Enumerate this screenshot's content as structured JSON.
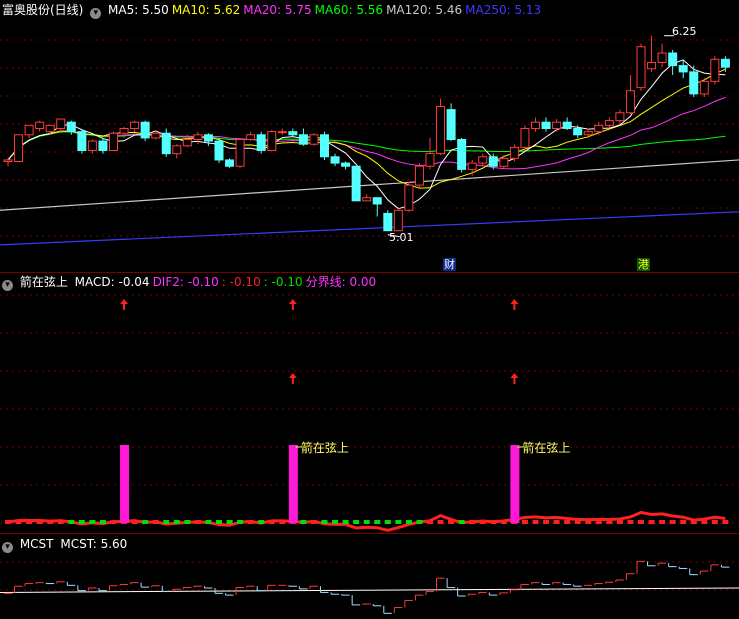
{
  "colors": {
    "bg": "#000000",
    "up": "#ff3a3a",
    "down": "#54ffff",
    "grid": "#7a0000",
    "ma5": "#ffffff",
    "ma10": "#ffff00",
    "ma20": "#ff33ff",
    "ma60": "#00ff00",
    "ma120": "#c8c8c8",
    "ma250": "#3a3aff",
    "signal": "#ff1ad9",
    "macd_red": "#ff2020",
    "macd_green": "#00e000"
  },
  "main": {
    "title": "富奥股份(日线)",
    "icon": "circle-chevron-icon",
    "ma": [
      {
        "label": "MA5: 5.50",
        "color": "#ffffff"
      },
      {
        "label": "MA10: 5.62",
        "color": "#ffff00"
      },
      {
        "label": "MA20: 5.75",
        "color": "#ff33ff"
      },
      {
        "label": "MA60: 5.56",
        "color": "#00ff00"
      },
      {
        "label": "MA120: 5.46",
        "color": "#c8c8c8"
      },
      {
        "label": "MA250: 5.13",
        "color": "#3a3aff"
      }
    ],
    "high_label": "6.25",
    "low_label": "5.01",
    "badge_cai": "财",
    "badge_gang": "港"
  },
  "ind": {
    "title": "箭在弦上",
    "icon": "circle-chevron-icon",
    "values": [
      {
        "label": "MACD: -0.04",
        "color": "#ffffff"
      },
      {
        "label": "DIF2: -0.10",
        "color": "#ff33ff"
      },
      {
        "label": ": -0.10",
        "color": "#ff2020"
      },
      {
        "label": ": -0.10",
        "color": "#00e000"
      },
      {
        "label": "分界线: 0.00",
        "color": "#ff33ff"
      }
    ],
    "signal_label": "箭在弦上"
  },
  "mcst": {
    "title": "MCST",
    "value": "MCST: 5.60",
    "icon": "circle-chevron-icon"
  },
  "candles": [
    [
      5.45,
      5.46,
      5.42,
      5.47
    ],
    [
      5.45,
      5.62,
      5.62,
      5.45
    ],
    [
      5.62,
      5.68,
      5.66,
      5.6
    ],
    [
      5.66,
      5.7,
      5.64,
      5.71
    ],
    [
      5.64,
      5.68,
      5.66,
      5.62
    ],
    [
      5.66,
      5.72,
      5.7,
      5.63
    ],
    [
      5.7,
      5.64,
      5.71,
      5.62
    ],
    [
      5.64,
      5.52,
      5.65,
      5.5
    ],
    [
      5.52,
      5.58,
      5.59,
      5.5
    ],
    [
      5.58,
      5.52,
      5.6,
      5.5
    ],
    [
      5.52,
      5.63,
      5.64,
      5.52
    ],
    [
      5.63,
      5.66,
      5.67,
      5.6
    ],
    [
      5.66,
      5.7,
      5.71,
      5.64
    ],
    [
      5.7,
      5.6,
      5.71,
      5.58
    ],
    [
      5.6,
      5.63,
      5.65,
      5.59
    ],
    [
      5.63,
      5.5,
      5.66,
      5.48
    ],
    [
      5.5,
      5.55,
      5.56,
      5.47
    ],
    [
      5.55,
      5.59,
      5.62,
      5.54
    ],
    [
      5.59,
      5.62,
      5.64,
      5.56
    ],
    [
      5.62,
      5.58,
      5.63,
      5.55
    ],
    [
      5.58,
      5.46,
      5.6,
      5.44
    ],
    [
      5.46,
      5.42,
      5.47,
      5.41
    ],
    [
      5.42,
      5.59,
      5.6,
      5.41
    ],
    [
      5.59,
      5.62,
      5.64,
      5.58
    ],
    [
      5.62,
      5.52,
      5.64,
      5.5
    ],
    [
      5.52,
      5.64,
      5.65,
      5.52
    ],
    [
      5.64,
      5.64,
      5.66,
      5.62
    ],
    [
      5.64,
      5.62,
      5.66,
      5.61
    ],
    [
      5.62,
      5.56,
      5.66,
      5.55
    ],
    [
      5.56,
      5.62,
      5.63,
      5.55
    ],
    [
      5.62,
      5.48,
      5.64,
      5.46
    ],
    [
      5.48,
      5.44,
      5.5,
      5.42
    ],
    [
      5.44,
      5.42,
      5.45,
      5.4
    ],
    [
      5.42,
      5.2,
      5.4,
      5.2
    ],
    [
      5.2,
      5.22,
      5.24,
      5.2
    ],
    [
      5.22,
      5.18,
      5.22,
      5.1
    ],
    [
      5.12,
      5.01,
      5.14,
      5.01
    ],
    [
      5.01,
      5.14,
      5.16,
      5.01
    ],
    [
      5.14,
      5.3,
      5.32,
      5.13
    ],
    [
      5.3,
      5.42,
      5.44,
      5.28
    ],
    [
      5.42,
      5.5,
      5.6,
      5.4
    ],
    [
      5.5,
      5.8,
      5.85,
      5.49
    ],
    [
      5.78,
      5.59,
      5.82,
      5.58
    ],
    [
      5.59,
      5.4,
      5.6,
      5.38
    ],
    [
      5.4,
      5.44,
      5.46,
      5.36
    ],
    [
      5.44,
      5.48,
      5.5,
      5.42
    ],
    [
      5.48,
      5.42,
      5.5,
      5.4
    ],
    [
      5.42,
      5.47,
      5.49,
      5.4
    ],
    [
      5.47,
      5.54,
      5.56,
      5.45
    ],
    [
      5.54,
      5.66,
      5.68,
      5.52
    ],
    [
      5.66,
      5.7,
      5.73,
      5.64
    ],
    [
      5.7,
      5.66,
      5.73,
      5.64
    ],
    [
      5.66,
      5.7,
      5.72,
      5.64
    ],
    [
      5.7,
      5.66,
      5.73,
      5.65
    ],
    [
      5.66,
      5.62,
      5.68,
      5.6
    ],
    [
      5.62,
      5.64,
      5.66,
      5.6
    ],
    [
      5.64,
      5.68,
      5.7,
      5.62
    ],
    [
      5.68,
      5.71,
      5.73,
      5.66
    ],
    [
      5.71,
      5.76,
      5.78,
      5.69
    ],
    [
      5.76,
      5.9,
      6.0,
      5.75
    ],
    [
      5.92,
      6.18,
      6.2,
      5.9
    ],
    [
      6.04,
      6.08,
      6.25,
      6.02
    ],
    [
      6.08,
      6.14,
      6.2,
      6.05
    ],
    [
      6.14,
      6.06,
      6.16,
      6.0
    ],
    [
      6.06,
      6.02,
      6.1,
      5.98
    ],
    [
      6.02,
      5.88,
      6.06,
      5.86
    ],
    [
      5.88,
      5.96,
      5.98,
      5.86
    ],
    [
      5.96,
      6.1,
      6.12,
      5.94
    ],
    [
      6.1,
      6.05,
      6.12,
      6.02
    ]
  ],
  "signals": [
    11,
    27,
    48
  ]
}
